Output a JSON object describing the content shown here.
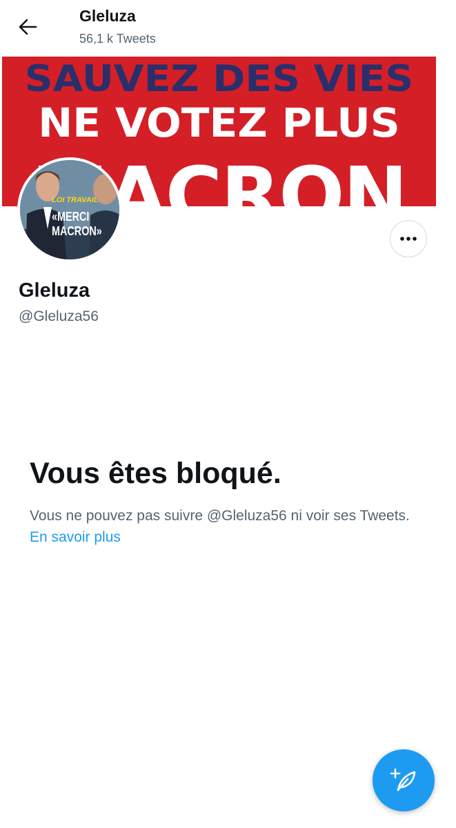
{
  "header": {
    "name": "Gleluza",
    "tweet_count": "56,1 k Tweets"
  },
  "banner": {
    "line1": "SAUVEZ DES VIES",
    "line2": "NE VOTEZ PLUS",
    "line3": "MACRON"
  },
  "avatar": {
    "caption_top": "LOI TRAVAIL",
    "caption_line1": "«MERCI",
    "caption_line2": "MACRON»"
  },
  "profile": {
    "name": "Gleluza",
    "handle": "@Gleluza56"
  },
  "blocked": {
    "title": "Vous êtes bloqué.",
    "text": "Vous ne pouvez pas suivre @Gleluza56 ni voir ses Tweets. ",
    "link": "En savoir plus"
  },
  "icons": {
    "back": "arrow-left-icon",
    "more": "more-horizontal-icon",
    "compose": "compose-tweet-icon"
  },
  "colors": {
    "accent": "#1d9bf0",
    "banner_red": "#d41f27",
    "banner_navy": "#2a2f6b",
    "secondary_text": "#536471"
  }
}
